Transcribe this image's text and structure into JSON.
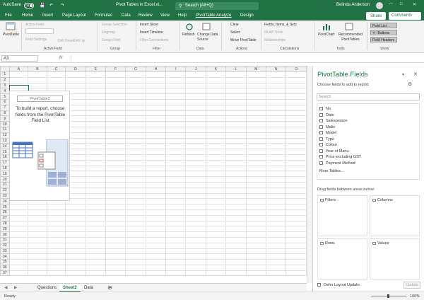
{
  "titlebar": {
    "autosave_label": "AutoSave",
    "autosave_state": "Off",
    "doc_title": "Pivot Tables in Excel.xl...",
    "search_placeholder": "Search (Alt+Q)",
    "user_name": "Belinda Anderson",
    "accent_color": "#217346"
  },
  "menu": {
    "tabs": [
      "File",
      "Home",
      "Insert",
      "Page Layout",
      "Formulas",
      "Data",
      "Review",
      "View",
      "Help",
      "PivotTable Analyze",
      "Design"
    ],
    "active_tab": "PivotTable Analyze",
    "share_label": "Share",
    "comments_label": "Comments"
  },
  "ribbon": {
    "pivottable_btn": "PivotTable",
    "active_field_label": "Active Field:",
    "field_settings": "Field Settings",
    "drill_down": "Drill Down",
    "drill_up": "Drill Up",
    "group_selection": "Group Selection",
    "ungroup": "Ungroup",
    "group_field": "Group Field",
    "insert_slicer": "Insert Slicer",
    "insert_timeline": "Insert Timeline",
    "filter_connections": "Filter Connections",
    "refresh": "Refresh",
    "change_data_source": "Change Data Source",
    "clear": "Clear",
    "select": "Select",
    "move_pivottable": "Move PivotTable",
    "fields_items_sets": "Fields, Items, & Sets",
    "olap_tools": "OLAP Tools",
    "relationships": "Relationships",
    "pivotchart": "PivotChart",
    "recommended_pivottables": "Recommended PivotTables",
    "field_list": "Field List",
    "buttons": "+/- Buttons",
    "field_headers": "Field Headers",
    "groups": {
      "active_field": "Active Field",
      "group": "Group",
      "filter": "Filter",
      "data": "Data",
      "actions": "Actions",
      "calculations": "Calculations",
      "tools": "Tools",
      "show": "Show"
    }
  },
  "formula": {
    "name_box": "A3",
    "fx_label": "fx"
  },
  "grid": {
    "columns": [
      "A",
      "B",
      "C",
      "D",
      "E",
      "F",
      "G",
      "H",
      "I",
      "J",
      "K",
      "L",
      "M",
      "N",
      "O"
    ],
    "rows": [
      "1",
      "2",
      "3",
      "4",
      "5",
      "6",
      "7",
      "8",
      "9",
      "10",
      "11",
      "12",
      "13",
      "14",
      "15",
      "16",
      "17",
      "18",
      "19",
      "20",
      "21",
      "22",
      "23",
      "24",
      "25",
      "26",
      "27",
      "28",
      "29",
      "30",
      "31",
      "32",
      "33",
      "34",
      "35",
      "36",
      "37"
    ]
  },
  "pivot_placeholder": {
    "name": "PivotTable2",
    "instruction": "To build a report, choose fields from the PivotTable Field List"
  },
  "sheets": {
    "tabs": [
      "Questions",
      "Sheet2",
      "Data"
    ],
    "active": "Sheet2"
  },
  "status": {
    "ready": "Ready",
    "zoom": "100%"
  },
  "pane": {
    "title": "PivotTable Fields",
    "choose_label": "Choose fields to add to report:",
    "search_placeholder": "Search",
    "fields": [
      "No",
      "Date",
      "Salesperson",
      "Make",
      "Model",
      "Type",
      "Colour",
      "Year of Manu",
      "Price excluding GST",
      "Payment Method"
    ],
    "more_tables": "More Tables...",
    "drag_label": "Drag fields between areas below:",
    "areas": {
      "filters": "Filters",
      "columns": "Columns",
      "rows": "Rows",
      "values": "Values"
    },
    "defer_label": "Defer Layout Update",
    "update_label": "Update"
  }
}
